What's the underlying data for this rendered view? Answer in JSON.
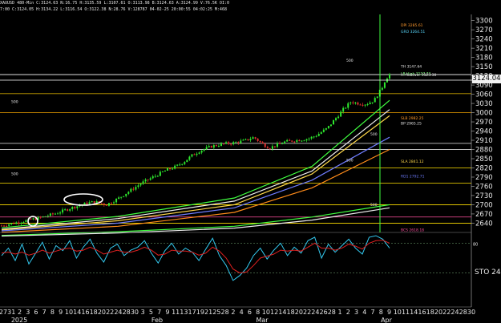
{
  "header": {
    "line1": "XAUUSD 480-Min  C:3124.63  N:16.75  H:3135.59  L:3107.61  O:3113.98  B:3124.63  A:3124.99  V:76.5K  OI:0",
    "line2": "7:00  C:3124.05  H:3134.22  L:3116.54  O:3122.38  N:28.76  V:128787  04-02-25  20:00:55  04:02:25  M:468"
  },
  "last_price_label": "3124.04",
  "oscillator_label": "STO 24,",
  "colors": {
    "background": "#000000",
    "up_candle": "#2ee82e",
    "down_candle": "#e23030",
    "stoch_fast": "#33c8ee",
    "stoch_slow": "#e02020",
    "ma_fast_green": "#40ff40",
    "ma_orange": "#ff8c1a",
    "ma_blue": "#6f7dff",
    "ma_white": "#f0f0f0",
    "ma_yellow": "#ffd84a"
  },
  "chart_data": [
    {
      "type": "candlestick",
      "title": "",
      "symbol": "XAUUSD",
      "interval": "480-Min",
      "ylim": [
        2615,
        3320
      ],
      "y_ticks": [
        3300,
        3270,
        3240,
        3210,
        3180,
        3150,
        3120,
        3090,
        3060,
        3030,
        3000,
        2970,
        2940,
        2910,
        2880,
        2850,
        2820,
        2790,
        2760,
        2730,
        2700,
        2670,
        2640
      ],
      "x_tick_labels": [
        "27",
        "31",
        "2",
        "3",
        "6",
        "7",
        "8",
        "9",
        "10",
        "14",
        "16",
        "18",
        "20",
        "22",
        "24",
        "28",
        "30",
        "3",
        "5",
        "7",
        "9",
        "11",
        "13",
        "17",
        "19",
        "21",
        "25",
        "28",
        "2",
        "4",
        "6",
        "8",
        "10",
        "12",
        "14",
        "18",
        "20",
        "22",
        "24",
        "26",
        "28",
        "1",
        "2",
        "3",
        "4",
        "7",
        "8",
        "9",
        "10",
        "11",
        "14",
        "16",
        "18",
        "20",
        "22",
        "24",
        "28",
        "30"
      ],
      "month_labels": [
        "2025",
        "Feb",
        "Mar",
        "Apr"
      ],
      "close_path": [
        [
          0,
          2632
        ],
        [
          5,
          2645
        ],
        [
          10,
          2658
        ],
        [
          14,
          2672
        ],
        [
          18,
          2690
        ],
        [
          22,
          2705
        ],
        [
          24,
          2710
        ],
        [
          27,
          2700
        ],
        [
          30,
          2720
        ],
        [
          33,
          2745
        ],
        [
          36,
          2770
        ],
        [
          39,
          2790
        ],
        [
          42,
          2810
        ],
        [
          45,
          2825
        ],
        [
          47,
          2840
        ],
        [
          49,
          2860
        ],
        [
          51,
          2875
        ],
        [
          54,
          2890
        ],
        [
          57,
          2898
        ],
        [
          60,
          2902
        ],
        [
          63,
          2910
        ],
        [
          65,
          2920
        ],
        [
          67,
          2900
        ],
        [
          69,
          2885
        ],
        [
          71,
          2895
        ],
        [
          73,
          2905
        ],
        [
          76,
          2910
        ],
        [
          79,
          2915
        ],
        [
          81,
          2925
        ],
        [
          84,
          2950
        ],
        [
          86,
          2980
        ],
        [
          88,
          3010
        ],
        [
          90,
          3035
        ],
        [
          92,
          3030
        ],
        [
          94,
          3028
        ],
        [
          96,
          3040
        ],
        [
          98,
          3080
        ],
        [
          99,
          3110
        ],
        [
          100,
          3124
        ]
      ],
      "moving_averages": [
        {
          "color": "#40ff40",
          "path": [
            [
              0,
              2625
            ],
            [
              30,
              2662
            ],
            [
              60,
              2722
            ],
            [
              80,
              2825
            ],
            [
              100,
              3040
            ]
          ]
        },
        {
          "color": "#f0f0f0",
          "path": [
            [
              0,
              2620
            ],
            [
              30,
              2655
            ],
            [
              60,
              2712
            ],
            [
              80,
              2810
            ],
            [
              100,
              3010
            ]
          ]
        },
        {
          "color": "#ffd84a",
          "path": [
            [
              0,
              2618
            ],
            [
              30,
              2648
            ],
            [
              60,
              2700
            ],
            [
              80,
              2800
            ],
            [
              100,
              2990
            ]
          ]
        },
        {
          "color": "#6f7dff",
          "path": [
            [
              0,
              2615
            ],
            [
              30,
              2640
            ],
            [
              60,
              2690
            ],
            [
              80,
              2780
            ],
            [
              100,
              2920
            ]
          ]
        },
        {
          "color": "#ff8c1a",
          "path": [
            [
              0,
              2610
            ],
            [
              30,
              2630
            ],
            [
              60,
              2675
            ],
            [
              80,
              2755
            ],
            [
              100,
              2880
            ]
          ]
        },
        {
          "color": "#40ff40",
          "path": [
            [
              0,
              2600
            ],
            [
              30,
              2612
            ],
            [
              60,
              2630
            ],
            [
              80,
              2660
            ],
            [
              100,
              2700
            ]
          ]
        },
        {
          "color": "#f0f0f0",
          "path": [
            [
              0,
              2598
            ],
            [
              30,
              2608
            ],
            [
              60,
              2624
            ],
            [
              80,
              2650
            ],
            [
              100,
              2690
            ]
          ]
        }
      ],
      "horizontal_levels": [
        {
          "price": 3124.04,
          "color": "#ffffff",
          "label": "3124.04"
        },
        {
          "price": 3062,
          "color": "#c8a000",
          "label": ""
        },
        {
          "price": 3000,
          "color": "#cc8a00",
          "label": ""
        },
        {
          "price": 2900,
          "color": "#e8e8e8",
          "label": ""
        },
        {
          "price": 2880,
          "color": "#ffffff",
          "label": ""
        },
        {
          "price": 2820,
          "color": "#ffe000",
          "label": ""
        },
        {
          "price": 2770,
          "color": "#ffe000",
          "label": ""
        },
        {
          "price": 2700,
          "color": "#ffe000",
          "label": ""
        },
        {
          "price": 2660,
          "color": "#ff4fa0",
          "label": ""
        },
        {
          "price": 2640,
          "color": "#ffe000",
          "label": ""
        }
      ],
      "annotations": [
        {
          "text": "DPI 3285.61",
          "price": 3285,
          "color": "#ff9a2e"
        },
        {
          "text": "GRO 3264.51",
          "price": 3264,
          "color": "#5ad9ff"
        },
        {
          "text": "TH 3147.64",
          "price": 3150,
          "color": "#e8e8e8"
        },
        {
          "text": "LB High 3127.73",
          "price": 3127,
          "color": "#80ff80"
        },
        {
          "text": "Hi Rollover 3123.30",
          "price": 3123,
          "color": "#e8e8e8"
        },
        {
          "text": "SLB 2982.25",
          "price": 2982,
          "color": "#ff9a2e"
        },
        {
          "text": "BP 2965.25",
          "price": 2965,
          "color": "#e8e8e8"
        },
        {
          "text": "SLA 2841.12",
          "price": 2841,
          "color": "#ffd84a"
        },
        {
          "text": "RD1 2792.71",
          "price": 2792,
          "color": "#6f7dff"
        },
        {
          "text": "BCS 2618.18",
          "price": 2618,
          "color": "#ff4fa0"
        },
        {
          "text": "500",
          "price": 3170,
          "color": "#e8e8e8"
        },
        {
          "text": "500",
          "price": 3035,
          "color": "#e8e8e8"
        },
        {
          "text": "500",
          "price": 2930,
          "color": "#e8e8e8"
        },
        {
          "text": "500",
          "price": 2845,
          "color": "#e8e8e8"
        },
        {
          "text": "500",
          "price": 2800,
          "color": "#e8e8e8"
        },
        {
          "text": "500",
          "price": 2700,
          "color": "#e8e8e8"
        }
      ]
    },
    {
      "type": "line",
      "title": "",
      "indicator_label": "STO 24,",
      "ylim": [
        0,
        100
      ],
      "y_ticks": [
        80,
        20
      ],
      "series": [
        {
          "color": "#33c8ee",
          "values": [
            55,
            70,
            45,
            78,
            38,
            60,
            82,
            48,
            75,
            65,
            85,
            50,
            72,
            88,
            60,
            42,
            70,
            78,
            55,
            66,
            72,
            85,
            60,
            40,
            65,
            80,
            58,
            70,
            62,
            45,
            68,
            90,
            55,
            35,
            5,
            15,
            30,
            55,
            70,
            48,
            66,
            80,
            55,
            72,
            60,
            85,
            92,
            50,
            78,
            62,
            75,
            88,
            70,
            58,
            92,
            95,
            88,
            70
          ]
        },
        {
          "color": "#e02020",
          "values": [
            60,
            62,
            58,
            62,
            56,
            60,
            66,
            60,
            64,
            68,
            70,
            64,
            66,
            72,
            66,
            58,
            62,
            66,
            62,
            62,
            66,
            72,
            66,
            56,
            58,
            66,
            64,
            64,
            62,
            56,
            60,
            72,
            64,
            50,
            28,
            20,
            22,
            35,
            50,
            54,
            58,
            66,
            64,
            66,
            64,
            72,
            80,
            70,
            70,
            66,
            70,
            78,
            74,
            68,
            80,
            85,
            86,
            80
          ]
        }
      ]
    }
  ]
}
